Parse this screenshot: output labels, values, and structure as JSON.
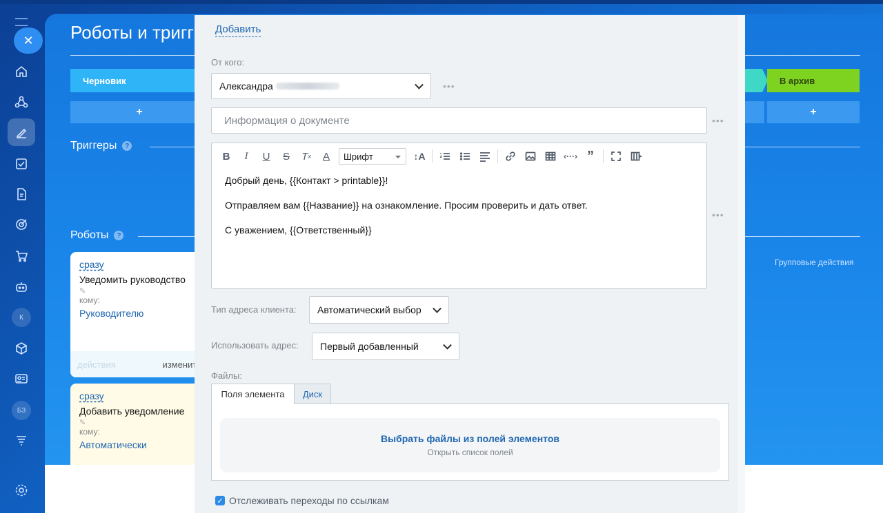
{
  "main": {
    "title": "Роботы и тригг",
    "stages": {
      "draft": "Черновик",
      "archive": "В архив"
    },
    "add_label": "+",
    "triggers_title": "Триггеры",
    "robots_title": "Роботы",
    "help_glyph": "?",
    "group_actions": "Групповые действия",
    "robots": [
      {
        "when": "сразу",
        "name": "Уведомить руководство",
        "to_label": "кому:",
        "to_value": "Руководителю",
        "action_a": "действия",
        "action_b": "изменить"
      },
      {
        "when": "сразу",
        "name": "Добавить уведомление",
        "to_label": "кому:",
        "to_value": "Автоматически"
      }
    ]
  },
  "rail": {
    "avatar_k": "К",
    "avatar_bz": "БЗ"
  },
  "modal": {
    "add_link": "Добавить",
    "from_label": "От кого:",
    "from_value": "Александра",
    "doc_info_placeholder": "Информация о документе",
    "font_select": "Шрифт",
    "body_lines": [
      "Добрый день, {{Контакт > printable}}!",
      "Отправляем вам {{Название}} на ознакомление. Просим проверить и дать ответ.",
      "С уважением, {{Ответственный}}"
    ],
    "addr_type_label": "Тип адреса клиента:",
    "addr_type_value": "Автоматический выбор",
    "use_addr_label": "Использовать адрес:",
    "use_addr_value": "Первый добавленный",
    "files_label": "Файлы:",
    "tab_fields": "Поля элемента",
    "tab_disk": "Диск",
    "files_title": "Выбрать файлы из полей элементов",
    "files_sub": "Открыть список полей",
    "track_links": "Отслеживать переходы по ссылкам",
    "more_glyph": "•••"
  },
  "colors": {
    "accent": "#2067b0",
    "stage_draft": "#2fb5f7",
    "stage_archive": "#7ed321"
  }
}
